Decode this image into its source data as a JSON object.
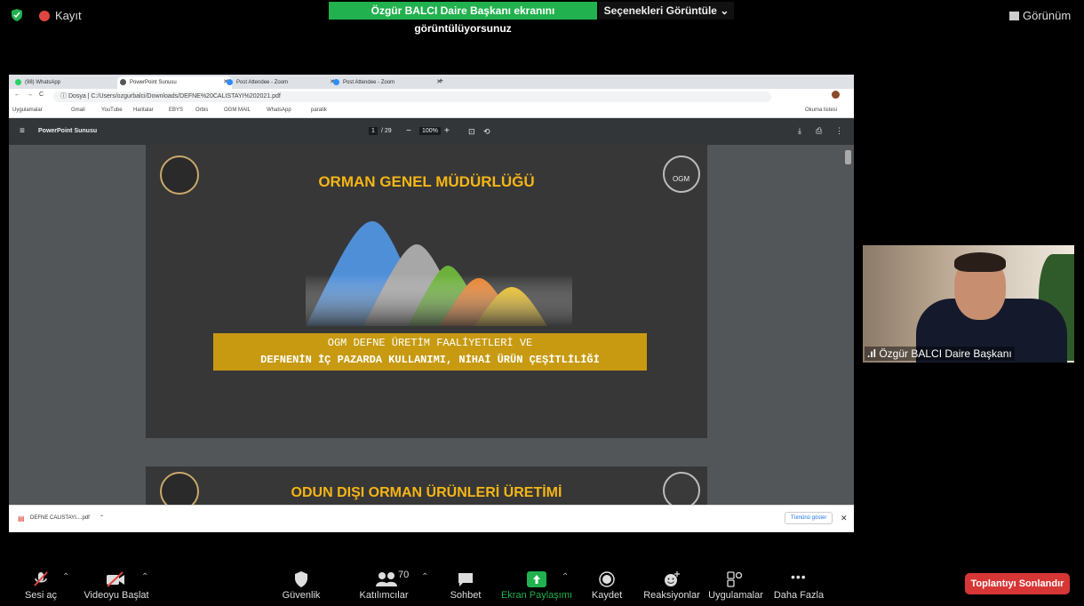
{
  "zoom_top": {
    "recording_label": "Kayıt",
    "share_banner": "Özgür BALCI Daire Başkanı ekranını görüntülüyorsunuz",
    "view_options": "Seçenekleri Görüntüle",
    "view_button": "Görünüm"
  },
  "browser": {
    "tabs": [
      {
        "label": "(98) WhatsApp",
        "icon_color": "#25d366"
      },
      {
        "label": "PowerPoint Sunusu",
        "icon_color": "#555555"
      },
      {
        "label": "Post Attendee - Zoom",
        "icon_color": "#2d8cff"
      },
      {
        "label": "Post Attendee - Zoom",
        "icon_color": "#2d8cff"
      }
    ],
    "url_prefix": "Dosya",
    "url": "C:/Users/ozgurbalci/Downloads/DEFNE%20CALISTAYI%202021.pdf",
    "bookmarks": [
      "Uygulamalar",
      "Gmail",
      "YouTube",
      "Haritalar",
      "EBYS",
      "Orbis",
      "OGM MAIL",
      "WhatsApp",
      "paratik"
    ],
    "reading_list": "Okuma listesi"
  },
  "pdf": {
    "title": "PowerPoint Sunusu",
    "page_current": "1",
    "page_total": "/ 29",
    "zoom": "100%",
    "slide1_title": "ORMAN GENEL MÜDÜRLÜĞÜ",
    "slide1_banner_line1": "OGM DEFNE ÜRETİM FAALİYETLERİ VE",
    "slide1_banner_line2": "DEFNENİN İÇ PAZARDA KULLANIMI, NİHAİ ÜRÜN ÇEŞİTLİLİĞİ",
    "slide2_title": "ODUN DIŞI ORMAN ÜRÜNLERİ ÜRETİMİ",
    "emblem_text": "OGM",
    "mountain_colors": [
      "#4f8fd8",
      "#a7a7a7",
      "#6bb13a",
      "#e8812b",
      "#f3c21a"
    ]
  },
  "download": {
    "file": "DEFNE CALISTAYI....pdf",
    "show_all": "Tümünü göster"
  },
  "video": {
    "name": "Özgür BALCI Daire Başkanı"
  },
  "toolbar": {
    "mute": "Sesi aç",
    "video": "Videoyu Başlat",
    "security": "Güvenlik",
    "participants": "Katılımcılar",
    "participant_count": "70",
    "chat": "Sohbet",
    "share": "Ekran Paylaşımı",
    "record": "Kaydet",
    "reactions": "Reaksiyonlar",
    "apps": "Uygulamalar",
    "more": "Daha Fazla",
    "end": "Toplantıyı Sonlandır"
  }
}
